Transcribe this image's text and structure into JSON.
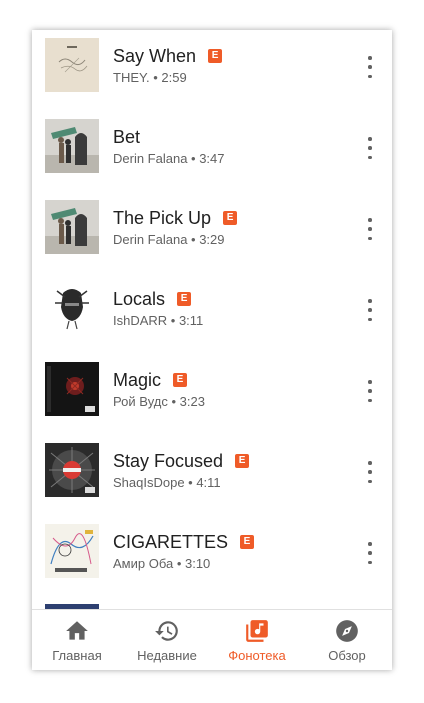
{
  "accent_color": "#ef5b28",
  "explicit_label": "E",
  "tracks": [
    {
      "title": "Say When",
      "subtitle": "THEY. • 2:59",
      "explicit": true,
      "art": "say-when-cover"
    },
    {
      "title": "Bet",
      "subtitle": "Derin Falana • 3:47",
      "explicit": false,
      "art": "derin-falana-cover"
    },
    {
      "title": "The Pick Up",
      "subtitle": "Derin Falana • 3:29",
      "explicit": true,
      "art": "derin-falana-cover"
    },
    {
      "title": "Locals",
      "subtitle": "IshDARR • 3:11",
      "explicit": true,
      "art": "ishdarr-cover"
    },
    {
      "title": "Magic",
      "subtitle": "Рой Вудс • 3:23",
      "explicit": true,
      "art": "roy-woods-cover"
    },
    {
      "title": "Stay Focused",
      "subtitle": "ShaqIsDope • 4:11",
      "explicit": true,
      "art": "shaqisdope-cover"
    },
    {
      "title": "CIGARETTES",
      "subtitle": "Амир Оба • 3:10",
      "explicit": true,
      "art": "amir-obe-cover"
    }
  ],
  "bottom_nav": {
    "items": [
      {
        "label": "Главная",
        "icon": "home-icon",
        "active": false
      },
      {
        "label": "Недавние",
        "icon": "history-icon",
        "active": false
      },
      {
        "label": "Фонотека",
        "icon": "library-music-icon",
        "active": true
      },
      {
        "label": "Обзор",
        "icon": "explore-icon",
        "active": false
      }
    ]
  }
}
